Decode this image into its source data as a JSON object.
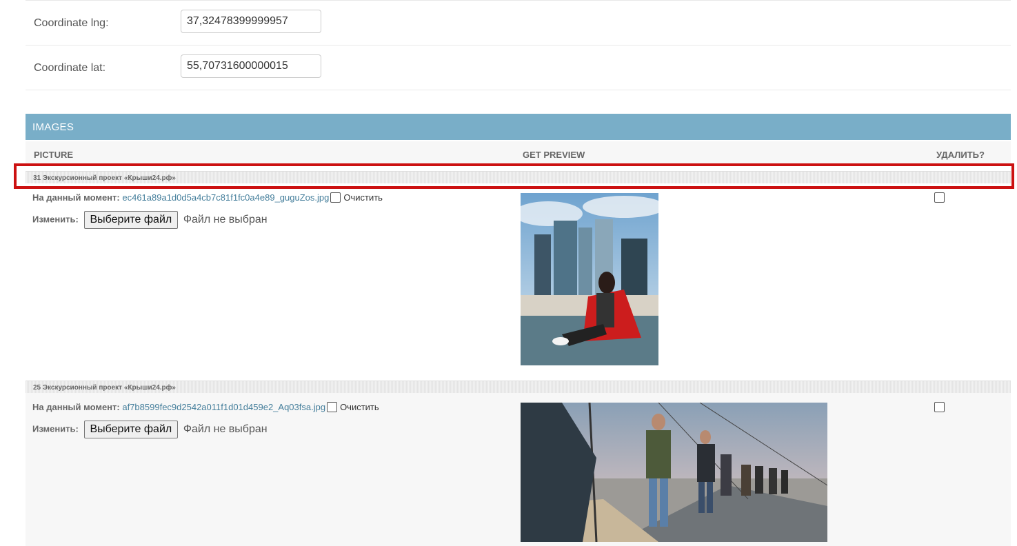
{
  "fields": [
    {
      "label": "Coordinate lng:",
      "value": "37,32478399999957"
    },
    {
      "label": "Coordinate lat:",
      "value": "55,70731600000015"
    }
  ],
  "inline": {
    "title": "IMAGES",
    "columns": {
      "picture": "PICTURE",
      "preview": "GET PREVIEW",
      "delete": "УДАЛИТЬ?"
    },
    "items": [
      {
        "title": "31 Экскурсионный проект «Крыши24.рф»",
        "current_label": "На данный момент:",
        "file_name": "ec461a89a1d0d5a4cb7c81f1fc0a4e89_guguZos.jpg",
        "clear_label": "Очистить",
        "change_label": "Изменить:",
        "button_label": "Выберите файл",
        "no_file": "Файл не выбран"
      },
      {
        "title": "25 Экскурсионный проект «Крыши24.рф»",
        "current_label": "На данный момент:",
        "file_name": "af7b8599fec9d2542a011f1d01d459e2_Aq03fsa.jpg",
        "clear_label": "Очистить",
        "change_label": "Изменить:",
        "button_label": "Выберите файл",
        "no_file": "Файл не выбран"
      }
    ]
  },
  "colors": {
    "header": "#79aec8",
    "link": "#447e9b",
    "highlight": "#cc1111"
  }
}
